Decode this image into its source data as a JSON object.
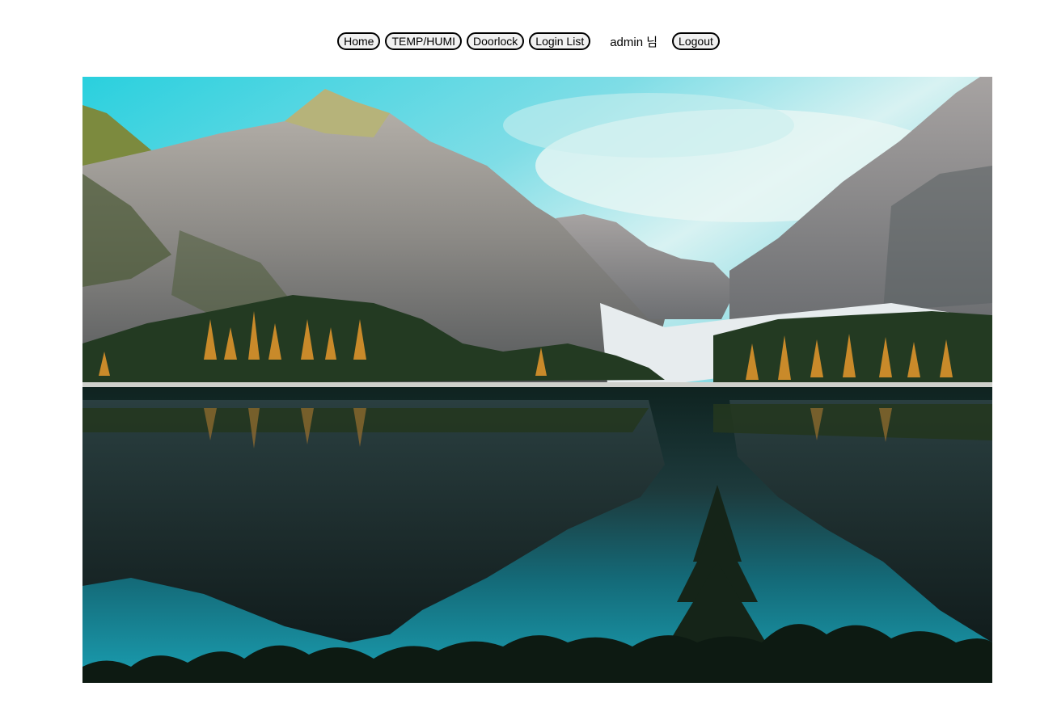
{
  "nav": {
    "home_label": "Home",
    "temp_humi_label": "TEMP/HUMI",
    "doorlock_label": "Doorlock",
    "login_list_label": "Login List",
    "user_greeting": "admin 님",
    "logout_label": "Logout"
  },
  "hero": {
    "alt": "Mountain lake landscape photo"
  },
  "colors": {
    "button_border": "#000000",
    "button_bg": "#f1f1f1",
    "page_bg": "#ffffff"
  }
}
